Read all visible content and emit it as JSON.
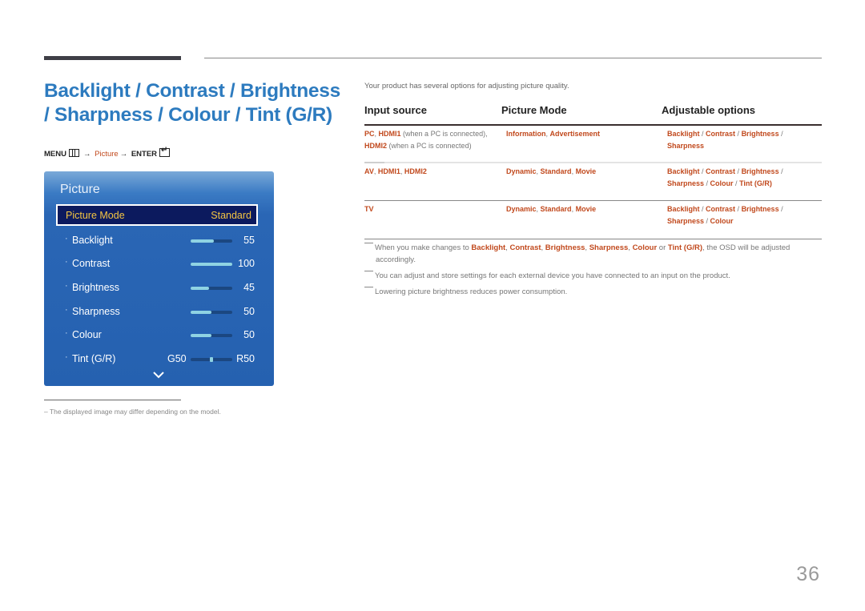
{
  "title": "Backlight / Contrast / Brightness / Sharpness / Colour / Tint (G/R)",
  "menu_path": {
    "menu": "MENU",
    "menu_icon": "menu-grid-icon",
    "arrow": "→",
    "picture": "Picture",
    "enter": "ENTER",
    "enter_icon": "enter-key-icon"
  },
  "osd": {
    "title": "Picture",
    "selected": {
      "label": "Picture Mode",
      "value": "Standard"
    },
    "items": [
      {
        "label": "Backlight",
        "value": "55",
        "fill": 0.55
      },
      {
        "label": "Contrast",
        "value": "100",
        "fill": 1.0
      },
      {
        "label": "Brightness",
        "value": "45",
        "fill": 0.45
      },
      {
        "label": "Sharpness",
        "value": "50",
        "fill": 0.5
      },
      {
        "label": "Colour",
        "value": "50",
        "fill": 0.5
      }
    ],
    "tint": {
      "label": "Tint (G/R)",
      "left_value": "G50",
      "right_value": "R50",
      "position": 0.5
    },
    "more_icon": "chevron-down-icon",
    "colors": {
      "panel": "#2561b0",
      "selected_bg": "#0c1a5e",
      "selected_text": "#f4c542",
      "slider_fill": "#8fd3e3"
    }
  },
  "footnote": "The displayed image may differ depending on the model.",
  "intro": "Your product has several options for adjusting picture quality.",
  "table": {
    "headers": [
      "Input source",
      "Picture Mode",
      "Adjustable options"
    ],
    "rows": [
      {
        "source": [
          {
            "t": "PC",
            "h": true
          },
          {
            "t": ", "
          },
          {
            "t": "HDMI1",
            "h": true
          },
          {
            "t": " (when a PC is connected),"
          },
          {
            "br": true
          },
          {
            "t": "HDMI2",
            "h": true
          },
          {
            "t": " (when a PC is connected)"
          }
        ],
        "mode": [
          {
            "t": "Information",
            "h": true
          },
          {
            "t": ", "
          },
          {
            "t": "Advertisement",
            "h": true
          }
        ],
        "options": [
          {
            "t": "Backlight",
            "h": true
          },
          {
            "t": " / "
          },
          {
            "t": "Contrast",
            "h": true
          },
          {
            "t": " / "
          },
          {
            "t": "Brightness",
            "h": true
          },
          {
            "t": " /"
          },
          {
            "br": true
          },
          {
            "t": "Sharpness",
            "h": true
          }
        ]
      },
      {
        "source": [
          {
            "t": "AV",
            "h": true
          },
          {
            "t": ", "
          },
          {
            "t": "HDMI1",
            "h": true
          },
          {
            "t": ", "
          },
          {
            "t": "HDMI2",
            "h": true
          }
        ],
        "mode": [
          {
            "t": "Dynamic",
            "h": true
          },
          {
            "t": ", "
          },
          {
            "t": "Standard",
            "h": true
          },
          {
            "t": ", "
          },
          {
            "t": "Movie",
            "h": true
          }
        ],
        "options": [
          {
            "t": "Backlight",
            "h": true
          },
          {
            "t": " / "
          },
          {
            "t": "Contrast",
            "h": true
          },
          {
            "t": " / "
          },
          {
            "t": "Brightness",
            "h": true
          },
          {
            "t": " /"
          },
          {
            "br": true
          },
          {
            "t": "Sharpness",
            "h": true
          },
          {
            "t": " / "
          },
          {
            "t": "Colour",
            "h": true
          },
          {
            "t": " / "
          },
          {
            "t": "Tint (G/R)",
            "h": true
          }
        ]
      },
      {
        "source": [
          {
            "t": "TV",
            "h": true
          }
        ],
        "mode": [
          {
            "t": "Dynamic",
            "h": true
          },
          {
            "t": ", "
          },
          {
            "t": "Standard",
            "h": true
          },
          {
            "t": ", "
          },
          {
            "t": "Movie",
            "h": true
          }
        ],
        "options": [
          {
            "t": "Backlight",
            "h": true
          },
          {
            "t": " / "
          },
          {
            "t": "Contrast",
            "h": true
          },
          {
            "t": " / "
          },
          {
            "t": "Brightness",
            "h": true
          },
          {
            "t": " /"
          },
          {
            "br": true
          },
          {
            "t": "Sharpness",
            "h": true
          },
          {
            "t": " / "
          },
          {
            "t": "Colour",
            "h": true
          }
        ]
      }
    ]
  },
  "notes": [
    [
      {
        "t": "When you make changes to "
      },
      {
        "t": "Backlight",
        "h": true
      },
      {
        "t": ", "
      },
      {
        "t": "Contrast",
        "h": true
      },
      {
        "t": ", "
      },
      {
        "t": "Brightness",
        "h": true
      },
      {
        "t": ", "
      },
      {
        "t": "Sharpness",
        "h": true
      },
      {
        "t": ", "
      },
      {
        "t": "Colour",
        "h": true
      },
      {
        "t": " or "
      },
      {
        "t": "Tint (G/R)",
        "h": true
      },
      {
        "t": ", the OSD will be adjusted"
      },
      {
        "br": true
      },
      {
        "t": "accordingly."
      }
    ],
    [
      {
        "t": "You can adjust and store settings for each external device you have connected to an input on the product."
      }
    ],
    [
      {
        "t": "Lowering picture brightness reduces power consumption."
      }
    ]
  ],
  "page_number": "36",
  "colors": {
    "title": "#2d7bbf",
    "highlight": "#c1491d"
  }
}
